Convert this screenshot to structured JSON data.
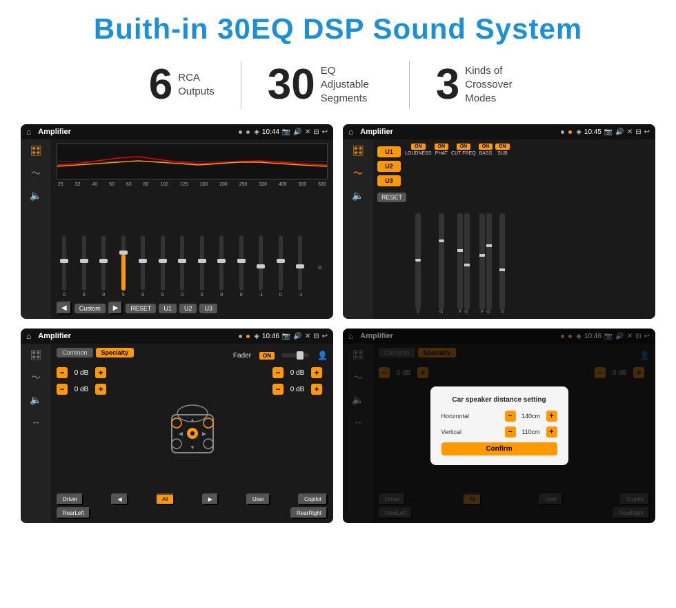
{
  "header": {
    "title": "Buith-in 30EQ DSP Sound System"
  },
  "features": [
    {
      "number": "6",
      "text_line1": "RCA",
      "text_line2": "Outputs"
    },
    {
      "number": "30",
      "text_line1": "EQ Adjustable",
      "text_line2": "Segments"
    },
    {
      "number": "3",
      "text_line1": "Kinds of",
      "text_line2": "Crossover Modes"
    }
  ],
  "screens": {
    "eq": {
      "app_name": "Amplifier",
      "time": "10:44",
      "freq_labels": [
        "25",
        "32",
        "40",
        "50",
        "63",
        "80",
        "100",
        "125",
        "160",
        "200",
        "250",
        "320",
        "400",
        "500",
        "630"
      ],
      "eq_values": [
        "0",
        "0",
        "0",
        "5",
        "0",
        "0",
        "0",
        "0",
        "0",
        "0",
        "-1",
        "0",
        "-1"
      ],
      "preset_label": "Custom",
      "buttons": [
        "RESET",
        "U1",
        "U2",
        "U3"
      ]
    },
    "crossover": {
      "app_name": "Amplifier",
      "time": "10:45",
      "presets": [
        "U1",
        "U2",
        "U3"
      ],
      "channels": [
        "LOUDNESS",
        "PHAT",
        "CUT FREQ",
        "BASS",
        "SUB"
      ],
      "reset_label": "RESET"
    },
    "fader": {
      "app_name": "Amplifier",
      "time": "10:46",
      "tabs": [
        "Common",
        "Specialty"
      ],
      "fader_label": "Fader",
      "on_label": "ON",
      "db_values": [
        "0 dB",
        "0 dB",
        "0 dB",
        "0 dB"
      ],
      "bottom_buttons": [
        "Driver",
        "All",
        "User",
        "RearLeft",
        "Copilot",
        "RearRight"
      ]
    },
    "fader_dialog": {
      "app_name": "Amplifier",
      "time": "10:46",
      "tabs": [
        "Common",
        "Specialty"
      ],
      "dialog_title": "Car speaker distance setting",
      "horizontal_label": "Horizontal",
      "horizontal_value": "140cm",
      "vertical_label": "Vertical",
      "vertical_value": "110cm",
      "confirm_label": "Confirm",
      "db_values": [
        "0 dB",
        "0 dB"
      ],
      "bottom_buttons": [
        "Driver",
        "All",
        "User",
        "RearLeft",
        "Copilot",
        "RearRight"
      ]
    }
  }
}
